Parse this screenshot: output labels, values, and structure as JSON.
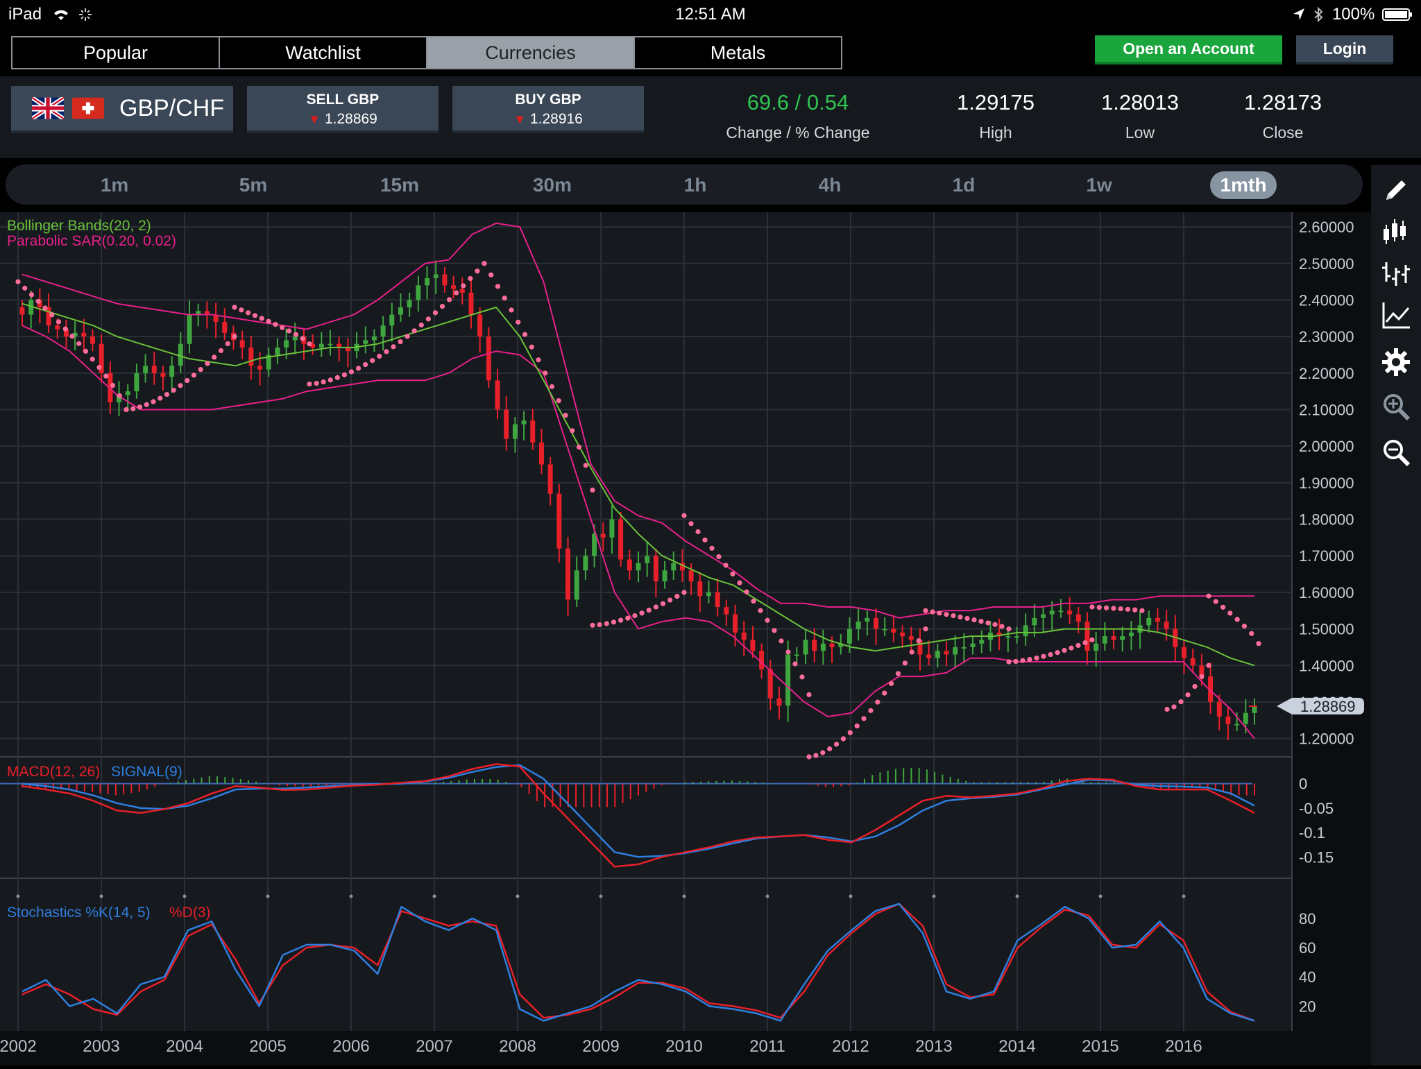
{
  "status_bar": {
    "device": "iPad",
    "time": "12:51 AM",
    "battery": "100%"
  },
  "nav_tabs": [
    {
      "label": "Popular",
      "active": false
    },
    {
      "label": "Watchlist",
      "active": false
    },
    {
      "label": "Currencies",
      "active": true
    },
    {
      "label": "Metals",
      "active": false
    }
  ],
  "header_buttons": {
    "open_account": "Open an Account",
    "login": "Login"
  },
  "instrument": {
    "pair": "GBP/CHF",
    "flags": [
      "uk-flag-icon",
      "swiss-flag-icon"
    ],
    "sell_label": "SELL GBP",
    "sell_price": "1.28869",
    "buy_label": "BUY GBP",
    "buy_price": "1.28916",
    "change": "69.6 / 0.54",
    "change_label": "Change / % Change",
    "high": "1.29175",
    "high_label": "High",
    "low": "1.28013",
    "low_label": "Low",
    "close": "1.28173",
    "close_label": "Close"
  },
  "timeframes": [
    {
      "label": "1m",
      "active": false
    },
    {
      "label": "5m",
      "active": false
    },
    {
      "label": "15m",
      "active": false
    },
    {
      "label": "30m",
      "active": false
    },
    {
      "label": "1h",
      "active": false
    },
    {
      "label": "4h",
      "active": false
    },
    {
      "label": "1d",
      "active": false
    },
    {
      "label": "1w",
      "active": false
    },
    {
      "label": "1mth",
      "active": true
    }
  ],
  "tools": [
    "pencil-icon",
    "candlestick-icon",
    "ohlc-bars-icon",
    "line-chart-icon",
    "settings-gear-icon",
    "zoom-in-icon",
    "zoom-out-icon"
  ],
  "colors": {
    "up": "#3fa63f",
    "down": "#e8202a",
    "bollinger": "#6bc23a",
    "bands": "#e8208c",
    "sar": "#ff6e9a",
    "macd": "#e8202a",
    "signal": "#2f7fe0",
    "accent_green": "#1aa53d"
  },
  "chart_data": {
    "type": "candlestick",
    "price_panel": {
      "legend": [
        "Bollinger Bands(20, 2)",
        "Parabolic SAR(0.20, 0.02)"
      ],
      "y_ticks": [
        "2.60000",
        "2.50000",
        "2.40000",
        "2.30000",
        "2.20000",
        "2.10000",
        "2.00000",
        "1.90000",
        "1.80000",
        "1.70000",
        "1.60000",
        "1.50000",
        "1.40000",
        "1.30000",
        "1.20000"
      ],
      "ylim": [
        1.15,
        2.64
      ],
      "last_price": "1.28869",
      "close_series": [
        2.36,
        2.4,
        2.38,
        2.33,
        2.32,
        2.3,
        2.31,
        2.3,
        2.28,
        2.2,
        2.12,
        2.14,
        2.15,
        2.2,
        2.22,
        2.2,
        2.19,
        2.22,
        2.28,
        2.36,
        2.37,
        2.36,
        2.34,
        2.31,
        2.29,
        2.27,
        2.22,
        2.21,
        2.25,
        2.27,
        2.29,
        2.3,
        2.28,
        2.27,
        2.28,
        2.28,
        2.27,
        2.26,
        2.28,
        2.29,
        2.3,
        2.33,
        2.36,
        2.38,
        2.4,
        2.44,
        2.46,
        2.47,
        2.44,
        2.43,
        2.42,
        2.36,
        2.3,
        2.18,
        2.1,
        2.02,
        2.06,
        2.07,
        2.01,
        1.95,
        1.87,
        1.72,
        1.58,
        1.66,
        1.7,
        1.76,
        1.75,
        1.8,
        1.69,
        1.66,
        1.68,
        1.7,
        1.63,
        1.66,
        1.68,
        1.66,
        1.63,
        1.59,
        1.6,
        1.56,
        1.54,
        1.49,
        1.47,
        1.44,
        1.39,
        1.31,
        1.29,
        1.43,
        1.43,
        1.47,
        1.44,
        1.46,
        1.45,
        1.46,
        1.5,
        1.52,
        1.53,
        1.5,
        1.5,
        1.49,
        1.48,
        1.47,
        1.43,
        1.42,
        1.44,
        1.43,
        1.45,
        1.45,
        1.46,
        1.47,
        1.49,
        1.48,
        1.48,
        1.48,
        1.51,
        1.53,
        1.54,
        1.55,
        1.55,
        1.54,
        1.52,
        1.44,
        1.46,
        1.48,
        1.47,
        1.48,
        1.49,
        1.51,
        1.53,
        1.52,
        1.5,
        1.45,
        1.42,
        1.4,
        1.37,
        1.3,
        1.26,
        1.24,
        1.24,
        1.27,
        1.29
      ],
      "bollinger_mid": [
        2.39,
        2.37,
        2.35,
        2.33,
        2.3,
        2.28,
        2.26,
        2.24,
        2.23,
        2.22,
        2.24,
        2.25,
        2.26,
        2.27,
        2.27,
        2.28,
        2.3,
        2.32,
        2.34,
        2.36,
        2.38,
        2.3,
        2.18,
        2.06,
        1.94,
        1.83,
        1.76,
        1.7,
        1.67,
        1.64,
        1.62,
        1.58,
        1.54,
        1.5,
        1.47,
        1.45,
        1.44,
        1.45,
        1.46,
        1.47,
        1.48,
        1.48,
        1.49,
        1.49,
        1.5,
        1.5,
        1.5,
        1.5,
        1.49,
        1.47,
        1.45,
        1.42,
        1.4
      ],
      "bollinger_upper": [
        2.47,
        2.45,
        2.43,
        2.41,
        2.39,
        2.38,
        2.37,
        2.36,
        2.36,
        2.35,
        2.34,
        2.33,
        2.32,
        2.34,
        2.36,
        2.4,
        2.45,
        2.5,
        2.51,
        2.58,
        2.61,
        2.6,
        2.45,
        2.2,
        1.95,
        1.85,
        1.81,
        1.79,
        1.74,
        1.7,
        1.66,
        1.61,
        1.57,
        1.57,
        1.56,
        1.56,
        1.55,
        1.53,
        1.54,
        1.55,
        1.55,
        1.56,
        1.56,
        1.56,
        1.57,
        1.57,
        1.58,
        1.58,
        1.59,
        1.59,
        1.59,
        1.59,
        1.59
      ],
      "bollinger_lower": [
        2.33,
        2.3,
        2.26,
        2.2,
        2.14,
        2.1,
        2.1,
        2.1,
        2.1,
        2.11,
        2.12,
        2.13,
        2.15,
        2.16,
        2.17,
        2.18,
        2.18,
        2.18,
        2.2,
        2.24,
        2.26,
        2.25,
        2.2,
        2.0,
        1.8,
        1.6,
        1.5,
        1.52,
        1.53,
        1.52,
        1.48,
        1.42,
        1.36,
        1.3,
        1.26,
        1.27,
        1.33,
        1.37,
        1.37,
        1.38,
        1.42,
        1.42,
        1.41,
        1.41,
        1.41,
        1.41,
        1.41,
        1.41,
        1.41,
        1.41,
        1.34,
        1.28,
        1.2
      ],
      "sar_segments": [
        {
          "from": 2002.0,
          "to": 2003.3,
          "start": 2.45,
          "end": 2.1
        },
        {
          "from": 2003.3,
          "to": 2004.6,
          "start": 2.1,
          "end": 2.3
        },
        {
          "from": 2004.6,
          "to": 2005.5,
          "start": 2.38,
          "end": 2.28
        },
        {
          "from": 2005.5,
          "to": 2007.6,
          "start": 2.17,
          "end": 2.5
        },
        {
          "from": 2007.6,
          "to": 2008.9,
          "start": 2.5,
          "end": 1.88
        },
        {
          "from": 2008.9,
          "to": 2010.0,
          "start": 1.51,
          "end": 1.6
        },
        {
          "from": 2010.0,
          "to": 2011.5,
          "start": 1.81,
          "end": 1.32
        },
        {
          "from": 2011.5,
          "to": 2012.9,
          "start": 1.15,
          "end": 1.5
        },
        {
          "from": 2012.9,
          "to": 2013.9,
          "start": 1.55,
          "end": 1.5
        },
        {
          "from": 2013.9,
          "to": 2014.9,
          "start": 1.41,
          "end": 1.47
        },
        {
          "from": 2014.9,
          "to": 2015.5,
          "start": 1.56,
          "end": 1.55
        },
        {
          "from": 2015.8,
          "to": 2016.3,
          "start": 1.28,
          "end": 1.4
        },
        {
          "from": 2016.3,
          "to": 2016.9,
          "start": 1.59,
          "end": 1.46
        }
      ]
    },
    "macd_panel": {
      "legend_macd": "MACD(12, 26)",
      "legend_signal": "SIGNAL(9)",
      "y_ticks": [
        "0",
        "-0.05",
        "-0.1",
        "-0.15"
      ],
      "ylim": [
        -0.185,
        0.035
      ],
      "macd": [
        -0.005,
        -0.012,
        -0.02,
        -0.035,
        -0.055,
        -0.06,
        -0.052,
        -0.04,
        -0.02,
        -0.005,
        -0.008,
        -0.013,
        -0.012,
        -0.008,
        -0.004,
        -0.002,
        0.002,
        0.005,
        0.015,
        0.03,
        0.04,
        0.035,
        -0.02,
        -0.07,
        -0.12,
        -0.17,
        -0.165,
        -0.15,
        -0.14,
        -0.13,
        -0.118,
        -0.11,
        -0.108,
        -0.105,
        -0.115,
        -0.12,
        -0.095,
        -0.065,
        -0.035,
        -0.025,
        -0.028,
        -0.025,
        -0.02,
        -0.01,
        0.005,
        0.01,
        0.008,
        -0.005,
        -0.012,
        -0.012,
        -0.012,
        -0.035,
        -0.06
      ],
      "signal": [
        0.0,
        -0.005,
        -0.012,
        -0.024,
        -0.04,
        -0.05,
        -0.052,
        -0.045,
        -0.03,
        -0.012,
        -0.01,
        -0.01,
        -0.008,
        -0.005,
        -0.003,
        -0.001,
        0.0,
        0.004,
        0.012,
        0.024,
        0.034,
        0.038,
        0.01,
        -0.04,
        -0.09,
        -0.14,
        -0.15,
        -0.148,
        -0.142,
        -0.133,
        -0.122,
        -0.112,
        -0.108,
        -0.105,
        -0.11,
        -0.118,
        -0.108,
        -0.085,
        -0.055,
        -0.035,
        -0.03,
        -0.027,
        -0.022,
        -0.012,
        -0.002,
        0.008,
        0.006,
        -0.002,
        -0.005,
        -0.006,
        -0.008,
        -0.02,
        -0.045
      ]
    },
    "stoch_panel": {
      "legend_k": "Stochastics %K(14, 5)",
      "legend_d": "%D(3)",
      "y_ticks": [
        "80",
        "60",
        "40",
        "20"
      ],
      "ylim": [
        5,
        98
      ],
      "k": [
        30,
        38,
        20,
        25,
        15,
        35,
        40,
        72,
        78,
        45,
        20,
        55,
        62,
        62,
        58,
        42,
        88,
        78,
        72,
        80,
        72,
        18,
        10,
        15,
        20,
        30,
        38,
        35,
        30,
        20,
        18,
        15,
        10,
        35,
        58,
        72,
        85,
        90,
        70,
        30,
        25,
        30,
        65,
        76,
        88,
        80,
        60,
        62,
        78,
        60,
        25,
        15,
        10
      ],
      "d": [
        28,
        35,
        28,
        18,
        14,
        30,
        38,
        68,
        76,
        52,
        22,
        48,
        60,
        62,
        60,
        48,
        85,
        80,
        75,
        78,
        75,
        28,
        12,
        14,
        18,
        26,
        36,
        36,
        32,
        22,
        20,
        17,
        12,
        30,
        55,
        70,
        83,
        90,
        75,
        35,
        26,
        28,
        60,
        74,
        86,
        82,
        62,
        60,
        76,
        65,
        30,
        16,
        10
      ]
    },
    "x_ticks": [
      "2002",
      "2003",
      "2004",
      "2005",
      "2006",
      "2007",
      "2008",
      "2009",
      "2010",
      "2011",
      "2012",
      "2013",
      "2014",
      "2015",
      "2016"
    ],
    "x_range": [
      2002.0,
      2016.9
    ]
  }
}
